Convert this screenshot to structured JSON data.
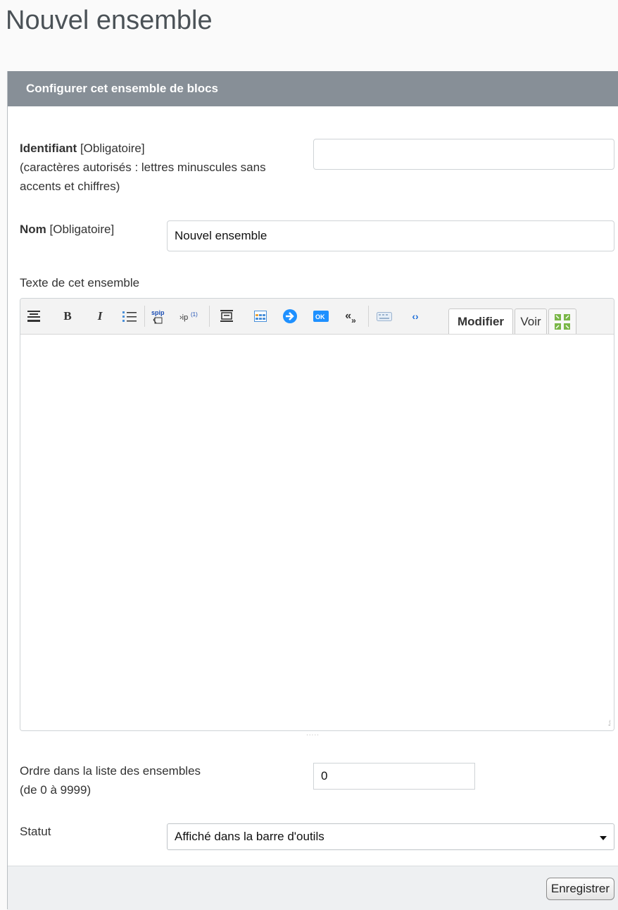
{
  "page": {
    "title": "Nouvel ensemble"
  },
  "panel": {
    "header": "Configurer cet ensemble de blocs"
  },
  "form": {
    "identifiant": {
      "label": "Identifiant",
      "required": "[Obligatoire]",
      "hint": "(caractères autorisés : lettres minuscules sans accents et chiffres)",
      "value": ""
    },
    "nom": {
      "label": "Nom",
      "required": "[Obligatoire]",
      "value": "Nouvel ensemble"
    },
    "texte": {
      "label": "Texte de cet ensemble",
      "value": ""
    },
    "ordre": {
      "label": "Ordre dans la liste des ensembles",
      "hint": "(de 0 à 9999)",
      "value": "0"
    },
    "statut": {
      "label": "Statut",
      "selected": "Affiché dans la barre d'outils"
    }
  },
  "toolbar": {
    "icons": [
      "heading-icon",
      "bold-icon",
      "italic-icon",
      "list-icon",
      "spip-link-icon",
      "footnote-icon",
      "insert-block-icon",
      "table-icon",
      "arrow-icon",
      "ok-icon",
      "quote-icon",
      "keyboard-icon",
      "code-icon",
      "fullscreen-icon"
    ],
    "tab_modifier": "Modifier",
    "tab_voir": "Voir"
  },
  "footer": {
    "save_label": "Enregistrer"
  }
}
